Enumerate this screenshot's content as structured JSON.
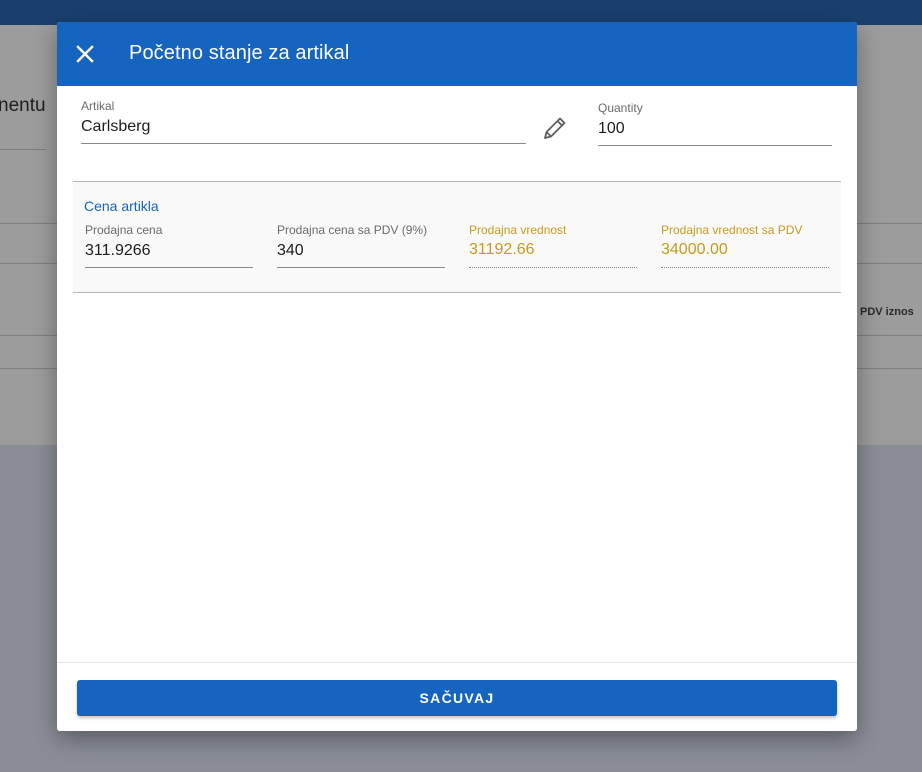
{
  "background": {
    "title_fragment": "nentu",
    "column_header_fragment": "PDV iznos"
  },
  "dialog": {
    "title": "Početno stanje za artikal",
    "close_icon": "close-icon",
    "edit_icon": "pencil-icon",
    "artikal": {
      "label": "Artikal",
      "value": "Carlsberg"
    },
    "quantity": {
      "label": "Quantity",
      "value": "100"
    },
    "price_section": {
      "title": "Cena artikla",
      "prodajna_cena": {
        "label": "Prodajna cena",
        "value": "311.9266"
      },
      "prodajna_cena_pdv": {
        "label": "Prodajna cena sa PDV (9%)",
        "value": "340"
      },
      "prodajna_vrednost": {
        "label": "Prodajna vrednost",
        "value": "31192.66"
      },
      "prodajna_vrednost_pdv": {
        "label": "Prodajna vrednost sa PDV",
        "value": "34000.00"
      }
    },
    "save_label": "SAČUVAJ"
  },
  "colors": {
    "primary": "#1565c0",
    "readonly_text": "#c79a1c",
    "topbar": "#1a3f6f"
  }
}
